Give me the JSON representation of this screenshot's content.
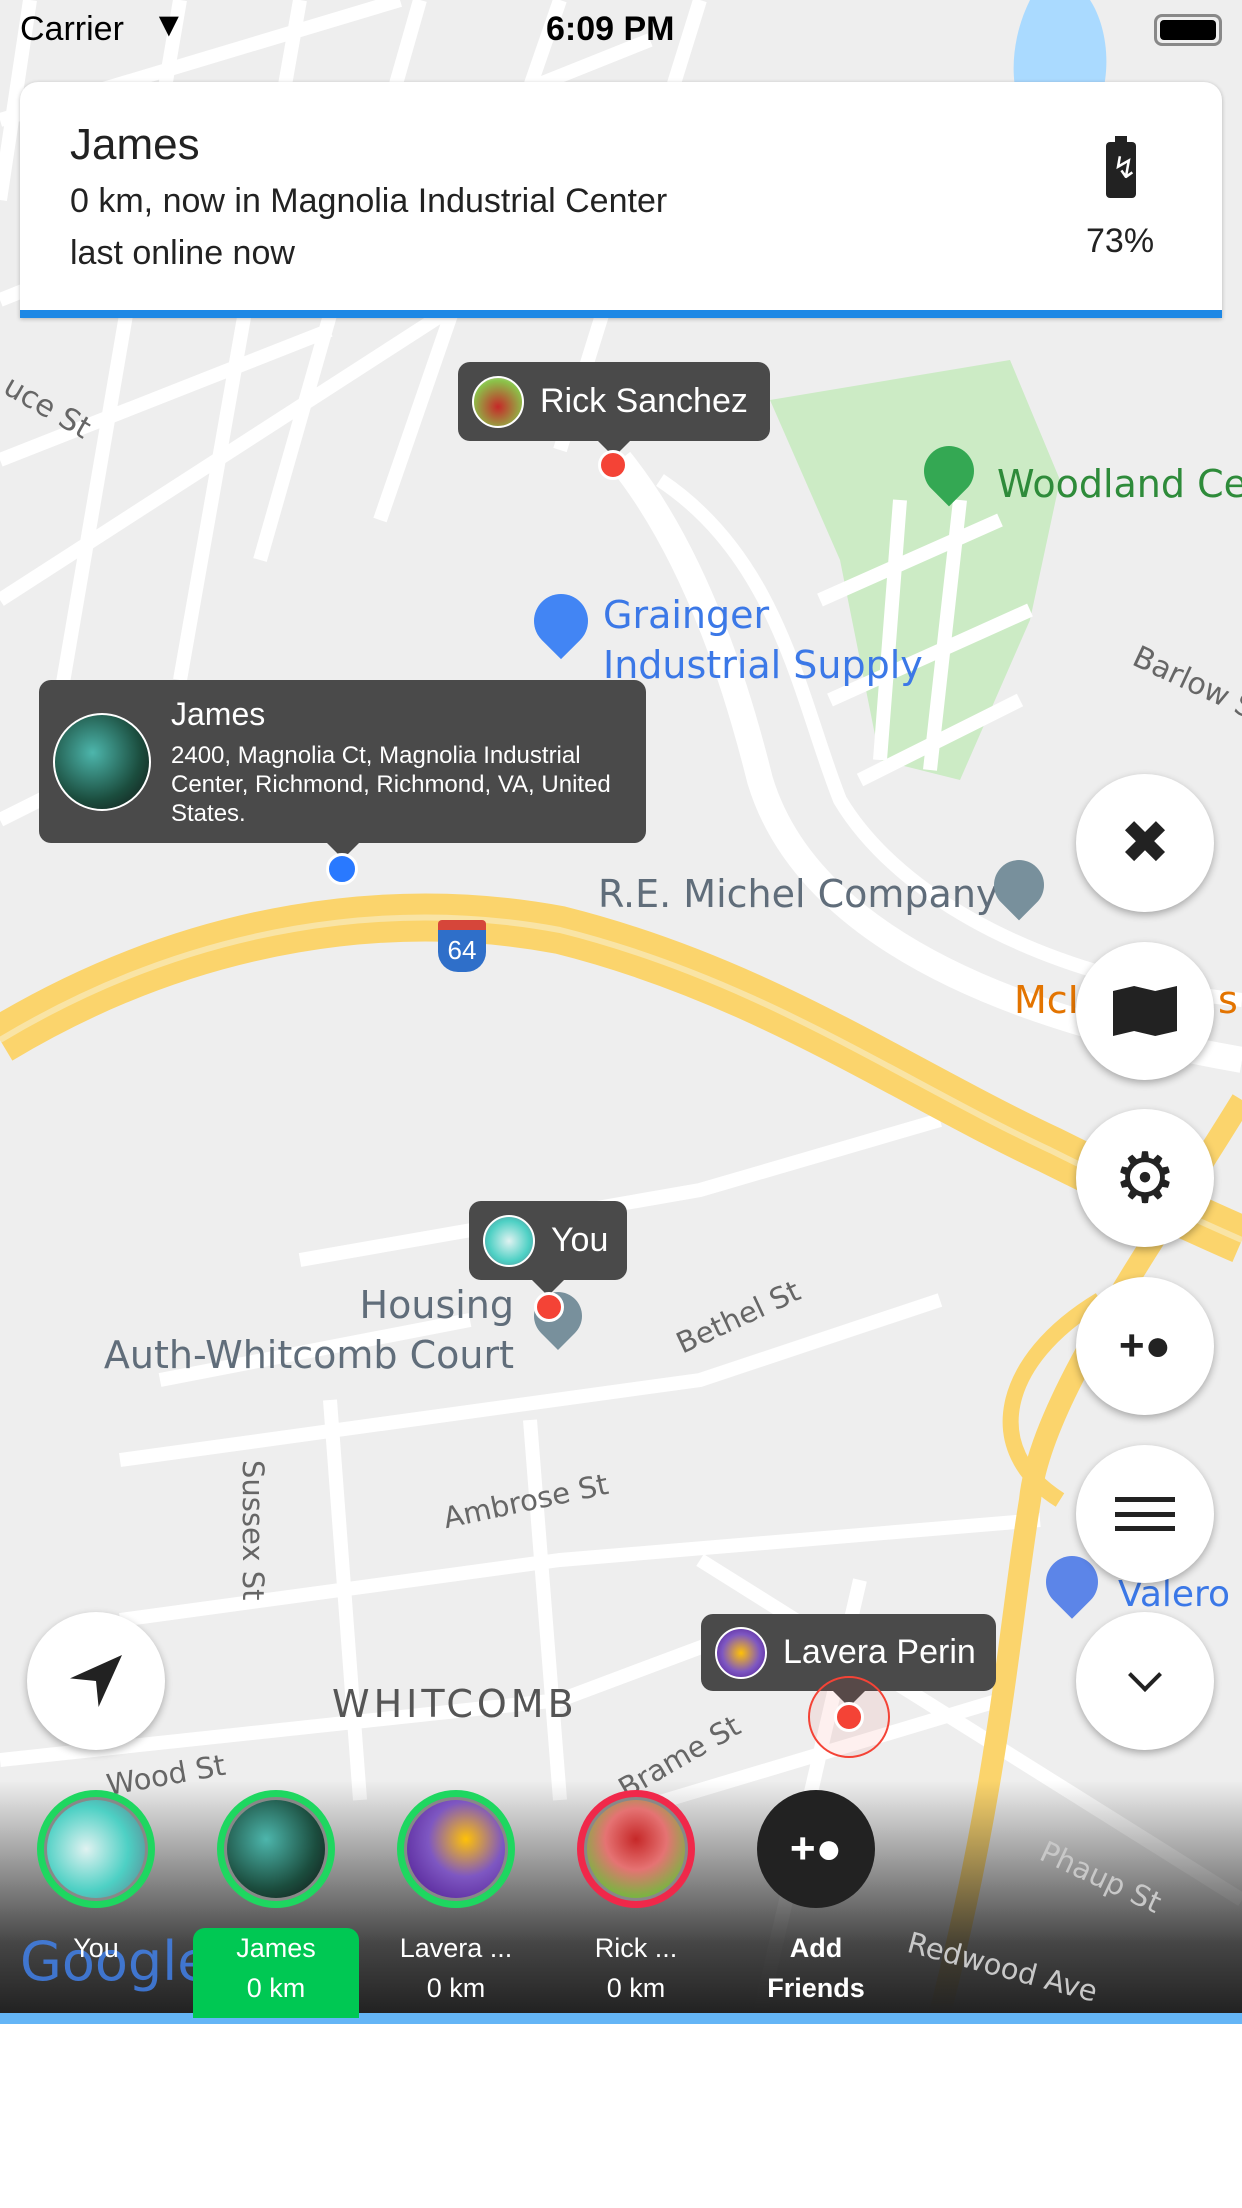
{
  "status_bar": {
    "carrier": "Carrier",
    "time": "6:09 PM"
  },
  "info_card": {
    "name": "James",
    "distance_line": "0 km, now in Magnolia Industrial Center",
    "last_online": "last online now",
    "battery": "73%",
    "accent": "#1e88e5"
  },
  "map_labels": {
    "woodland": "Woodland Ce",
    "grainger1": "Grainger",
    "grainger2": "Industrial Supply",
    "re_michel": "R.E. Michel Company",
    "mcd": "McI",
    "mcd2": "s",
    "highway": "64",
    "barlow": "Barlow St",
    "housing1": "Housing",
    "housing2": "Auth-Whitcomb Court",
    "bethel": "Bethel St",
    "sussex": "Sussex St",
    "ambrose": "Ambrose St",
    "valero": "Valero",
    "whitcomb": "WHITCOMB",
    "wood": "Wood St",
    "brame": "Brame St",
    "phaup": "Phaup St",
    "redwood": "Redwood Ave",
    "bruce": "uce St",
    "google": "Google"
  },
  "markers": {
    "rick": {
      "name": "Rick Sanchez",
      "color": "#f44336"
    },
    "james": {
      "name": "James",
      "address": "2400, Magnolia Ct, Magnolia Industrial Center, Richmond, Richmond, VA, United States.",
      "color": "#2979ff"
    },
    "you": {
      "name": "You",
      "color": "#f44336"
    },
    "lavera": {
      "name": "Lavera Perin",
      "color": "#f44336"
    }
  },
  "fab_buttons": [
    {
      "icon": "tools-icon"
    },
    {
      "icon": "map-icon"
    },
    {
      "icon": "gear-icon"
    },
    {
      "icon": "add-person-icon"
    },
    {
      "icon": "menu-icon"
    },
    {
      "icon": "chevron-down-icon"
    }
  ],
  "friends": [
    {
      "name": "You",
      "distance": "",
      "ring": "#1ed760"
    },
    {
      "name": "James",
      "distance": "0 km",
      "ring": "#1ed760",
      "selected": true
    },
    {
      "name": "Lavera ...",
      "distance": "0 km",
      "ring": "#1ed760"
    },
    {
      "name": "Rick ...",
      "distance": "0 km",
      "ring": "#f0284a"
    }
  ],
  "add_friends": {
    "line1": "Add",
    "line2": "Friends"
  }
}
